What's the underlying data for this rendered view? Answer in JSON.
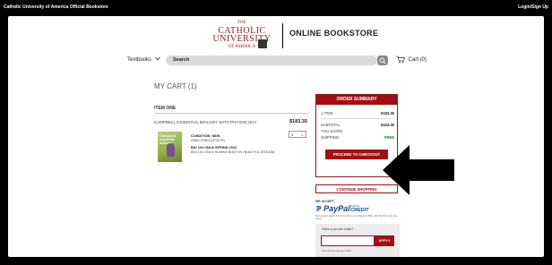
{
  "topbar": {
    "site_name": "Catholic University of America Official Bookstore",
    "login": "Login/Sign Up"
  },
  "logo": {
    "the": "THE",
    "name": "CATHOLIC",
    "name2": "UNIVERSITY",
    "name3": "OF AMERICA"
  },
  "header": {
    "bookstore": "ONLINE BOOKSTORE"
  },
  "nav": {
    "textbooks": "Textbooks",
    "search_label": "Search",
    "cart": "Cart (0)"
  },
  "cart": {
    "title": "MY CART (1)",
    "item_heading": "ITEM ONE",
    "item": {
      "title": "CAMPBELL ESSENTIAL BIOLOGY WITH PHYSIOLOGY",
      "price": "$183.35",
      "quantity": "1",
      "condition": "CONDITION: NEW",
      "isbn": "ISBN: 9780134711751",
      "section": "BIO 104 ONLN  SPRING 2022",
      "course": "BIO 104 ONLN HUMAN BODY IN HEALTH & DISEASE",
      "cover_text": [
        "Campbell",
        "essential",
        "biology"
      ]
    }
  },
  "summary": {
    "heading": "ORDER SUMMARY",
    "rows": [
      {
        "label": "1 ITEM",
        "value": "$183.35"
      },
      {
        "label": "SUBTOTAL:",
        "value": "$183.35"
      },
      {
        "label": "YOU SAVED:",
        "value": ""
      },
      {
        "label": "SHIPPING:",
        "value": "FREE"
      }
    ],
    "checkout": "PROCEED TO CHECKOUT",
    "continue": "CONTINUE SHOPPING"
  },
  "payment": {
    "we_accept": "WE ACCEPT",
    "paypal": "PayPal",
    "credit_small": "PayPal",
    "credit": "CREDIT",
    "note": "No Interest if paid in full in 6 months on purchases of $99+ with PayPal Credit. See terms."
  },
  "promo": {
    "question": "Have a promo code?",
    "apply": "APPLY",
    "note": "One promo code per order"
  },
  "colors": {
    "brand": "#a10e14",
    "free": "#1a7a2a"
  }
}
